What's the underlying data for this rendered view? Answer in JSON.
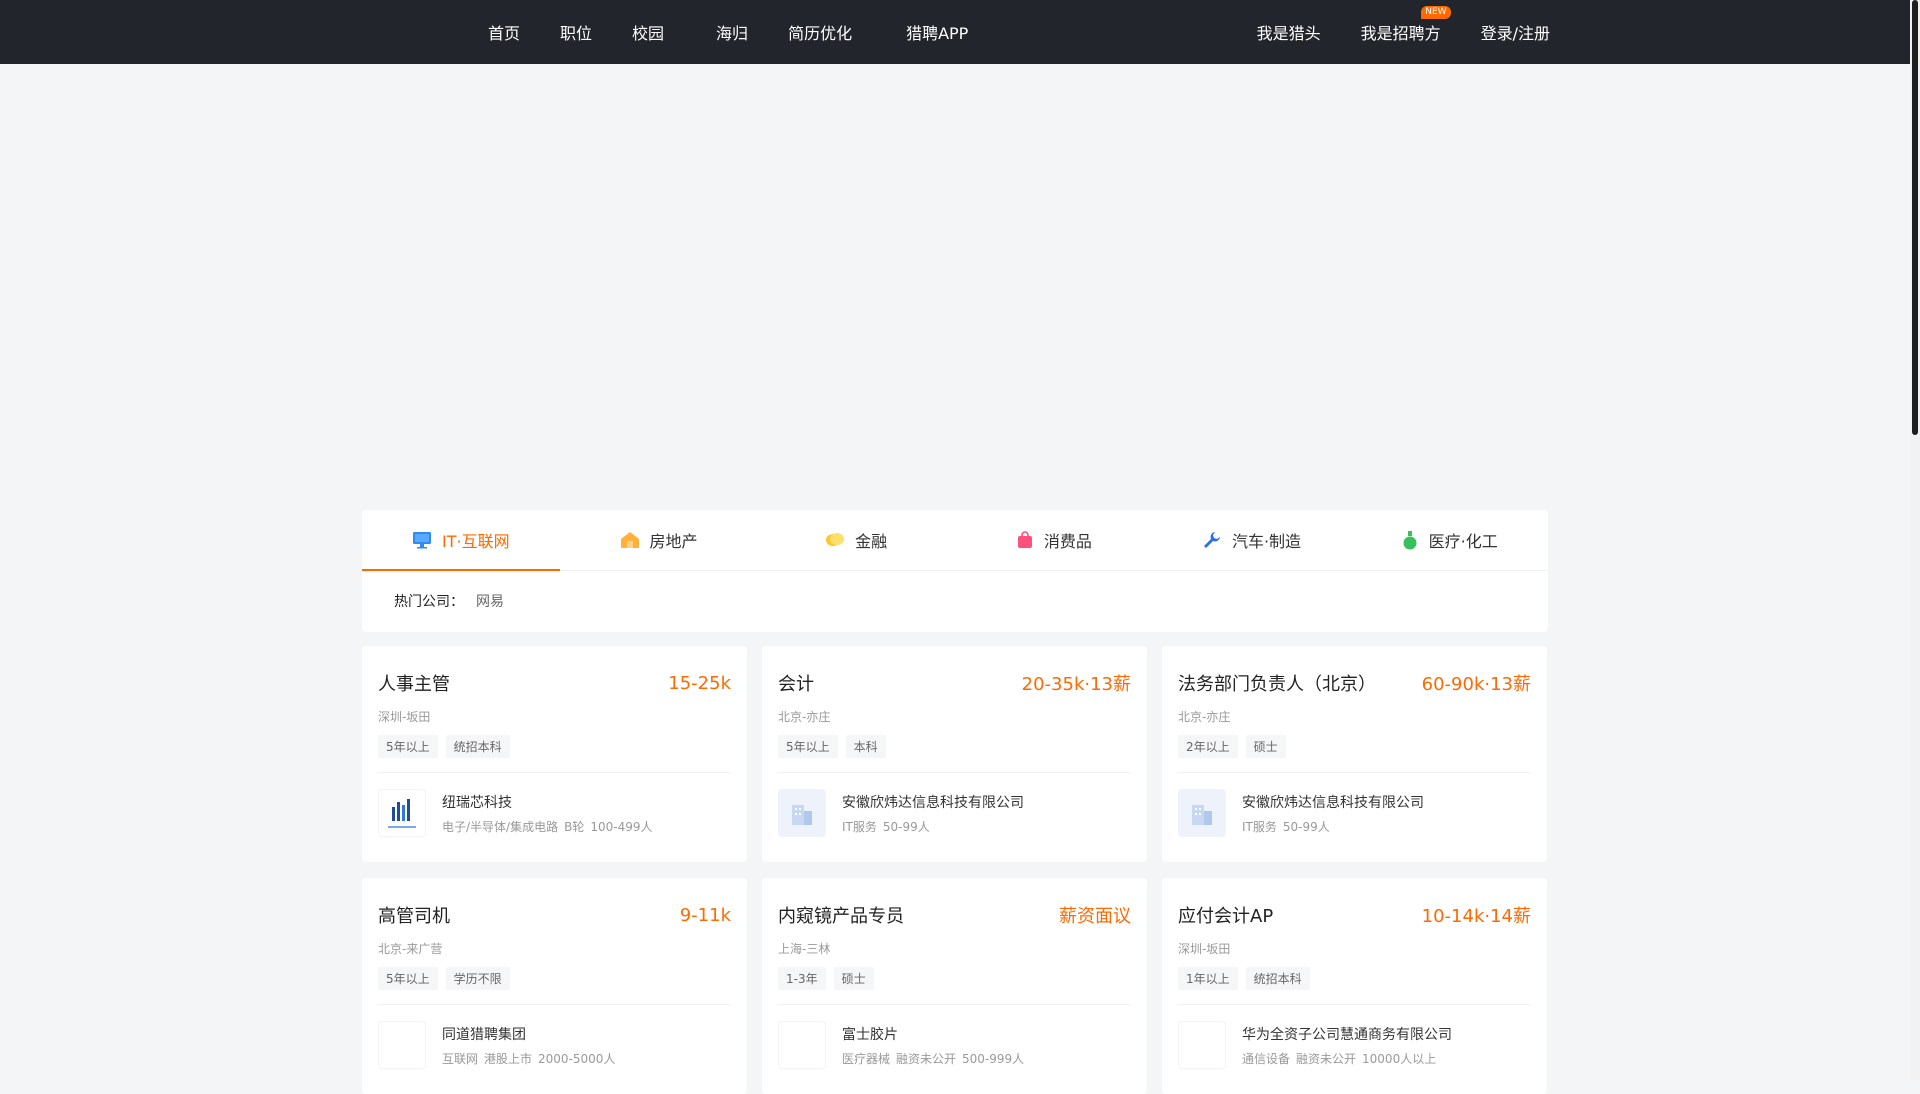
{
  "nav": {
    "left": [
      "首页",
      "职位",
      "校园",
      "海归",
      "简历优化",
      "猎聘APP"
    ],
    "right": [
      {
        "label": "我是猎头",
        "badge": ""
      },
      {
        "label": "我是招聘方",
        "badge": "NEW"
      },
      {
        "label": "登录/注册",
        "badge": ""
      }
    ]
  },
  "industry_tabs": [
    {
      "label": "IT·互联网",
      "icon": "monitor-icon",
      "active": true
    },
    {
      "label": "房地产",
      "icon": "house-icon",
      "active": false
    },
    {
      "label": "金融",
      "icon": "coins-icon",
      "active": false
    },
    {
      "label": "消费品",
      "icon": "shopping-bag-icon",
      "active": false
    },
    {
      "label": "汽车·制造",
      "icon": "wrench-icon",
      "active": false
    },
    {
      "label": "医疗·化工",
      "icon": "flask-icon",
      "active": false
    }
  ],
  "hot_companies": {
    "label": "热门公司：",
    "items": [
      "网易"
    ]
  },
  "jobs": [
    {
      "title": "人事主管",
      "salary": "15-25k",
      "location": "深圳-坂田",
      "tags": [
        "5年以上",
        "统招本科"
      ],
      "company": "纽瑞芯科技",
      "meta": [
        "电子/半导体/集成电路",
        "B轮",
        "100-499人"
      ],
      "logo": "nuruixin-logo"
    },
    {
      "title": "会计",
      "salary": "20-35k·13薪",
      "location": "北京-亦庄",
      "tags": [
        "5年以上",
        "本科"
      ],
      "company": "安徽欣炜达信息科技有限公司",
      "meta": [
        "IT服务",
        "50-99人"
      ],
      "logo": "building-placeholder-logo"
    },
    {
      "title": "法务部门负责人（北京）",
      "salary": "60-90k·13薪",
      "location": "北京-亦庄",
      "tags": [
        "2年以上",
        "硕士"
      ],
      "company": "安徽欣炜达信息科技有限公司",
      "meta": [
        "IT服务",
        "50-99人"
      ],
      "logo": "building-placeholder-logo"
    },
    {
      "title": "高管司机",
      "salary": "9-11k",
      "location": "北京-来广营",
      "tags": [
        "5年以上",
        "学历不限"
      ],
      "company": "同道猎聘集团",
      "meta": [
        "互联网",
        "港股上市",
        "2000-5000人"
      ],
      "logo": "blank-logo"
    },
    {
      "title": "内窥镜产品专员",
      "salary": "薪资面议",
      "location": "上海-三林",
      "tags": [
        "1-3年",
        "硕士"
      ],
      "company": "富士胶片",
      "meta": [
        "医疗器械",
        "融资未公开",
        "500-999人"
      ],
      "logo": "blank-logo"
    },
    {
      "title": "应付会计AP",
      "salary": "10-14k·14薪",
      "location": "深圳-坂田",
      "tags": [
        "1年以上",
        "统招本科"
      ],
      "company": "华为全资子公司慧通商务有限公司",
      "meta": [
        "通信设备",
        "融资未公开",
        "10000人以上"
      ],
      "logo": "blank-logo"
    }
  ],
  "colors": {
    "accent": "#ff6a00",
    "topbar": "#22252b"
  }
}
